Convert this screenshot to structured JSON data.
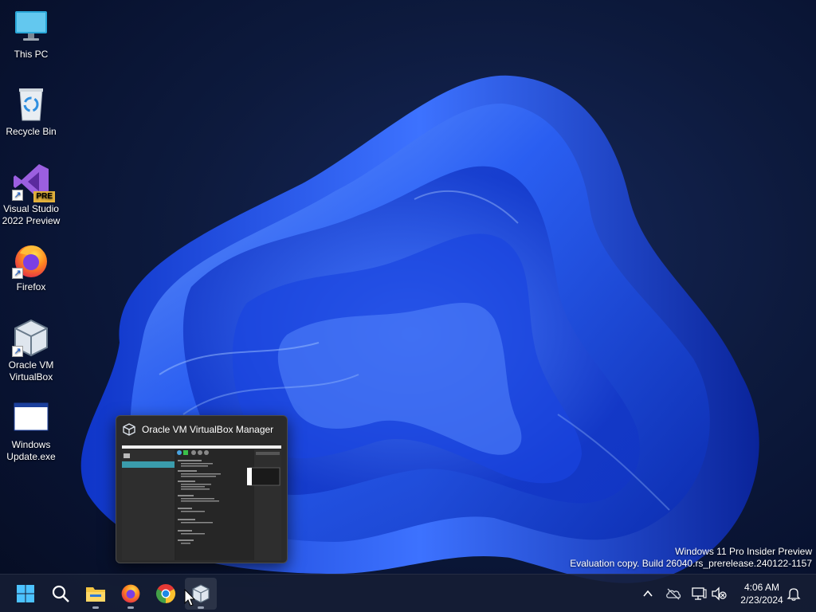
{
  "desktop": {
    "icons": [
      {
        "label": "This PC",
        "icon": "monitor-icon"
      },
      {
        "label": "Recycle Bin",
        "icon": "recycle-bin-icon"
      },
      {
        "label": "Visual Studio 2022 Preview",
        "icon": "visual-studio-icon",
        "badge": "PRE"
      },
      {
        "label": "Firefox",
        "icon": "firefox-icon"
      },
      {
        "label": "Oracle VM VirtualBox",
        "icon": "virtualbox-icon"
      },
      {
        "label": "Windows Update.exe",
        "icon": "window-exe-icon"
      }
    ]
  },
  "preview": {
    "title": "Oracle VM VirtualBox Manager"
  },
  "watermark": {
    "line1": "Windows 11 Pro Insider Preview",
    "line2": "Evaluation copy. Build 26040.rs_prerelease.240122-1157"
  },
  "taskbar": {
    "apps": [
      "start-icon",
      "search-icon",
      "file-explorer-icon",
      "firefox-icon",
      "chrome-icon",
      "virtualbox-icon"
    ],
    "tray": [
      "chevron-up-icon",
      "onedrive-icon",
      "network-icon",
      "volume-muted-icon",
      "notification-bell-icon"
    ]
  },
  "clock": {
    "time": "4:06 AM",
    "date": "2/23/2024"
  },
  "colors": {
    "bloom_dark": "#0a2fb8",
    "bloom_mid": "#1f55f0",
    "bloom_light": "#6fa0ff",
    "desktop_bg": "#0b1633",
    "taskbar_bg": "#161e34"
  }
}
